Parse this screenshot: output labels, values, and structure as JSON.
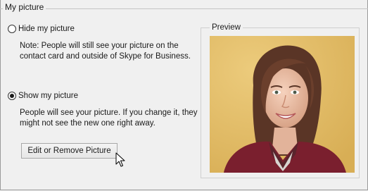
{
  "group": {
    "title": "My picture"
  },
  "options": {
    "hide": {
      "label": "Hide my picture",
      "selected": false,
      "note": "Note: People will still see your picture on the contact card and outside of Skype for Business."
    },
    "show": {
      "label": "Show my picture",
      "selected": true,
      "note": "People will see your picture. If you change it, they might not see the new one right away."
    }
  },
  "button": {
    "label": "Edit or Remove Picture"
  },
  "preview": {
    "title": "Preview"
  },
  "colors": {
    "background": "#f0f0f0",
    "photo_backdrop": "#e3bf6a",
    "shirt": "#7a1f2e"
  }
}
